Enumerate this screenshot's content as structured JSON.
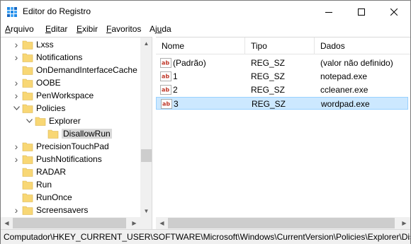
{
  "window": {
    "title": "Editor do Registro"
  },
  "menu": [
    {
      "accel": "A",
      "rest": "rquivo"
    },
    {
      "accel": "E",
      "rest": "ditar"
    },
    {
      "accel": "E",
      "rest": "xibir"
    },
    {
      "accel": "F",
      "rest": "avoritos"
    },
    {
      "pre": "Aj",
      "accel": "u",
      "rest": "da"
    }
  ],
  "tree": {
    "items": [
      {
        "label": "Lxss",
        "expander": "right"
      },
      {
        "label": "Notifications",
        "expander": "right"
      },
      {
        "label": "OnDemandInterfaceCache",
        "expander": "none"
      },
      {
        "label": "OOBE",
        "expander": "right"
      },
      {
        "label": "PenWorkspace",
        "expander": "right"
      },
      {
        "label": "Policies",
        "expander": "down"
      },
      {
        "label": "Explorer",
        "expander": "down"
      },
      {
        "label": "DisallowRun",
        "expander": "none",
        "selected": true
      },
      {
        "label": "PrecisionTouchPad",
        "expander": "right"
      },
      {
        "label": "PushNotifications",
        "expander": "right"
      },
      {
        "label": "RADAR",
        "expander": "none"
      },
      {
        "label": "Run",
        "expander": "none"
      },
      {
        "label": "RunOnce",
        "expander": "none"
      },
      {
        "label": "Screensavers",
        "expander": "right"
      }
    ]
  },
  "list": {
    "columns": {
      "name": "Nome",
      "type": "Tipo",
      "data": "Dados"
    },
    "rows": [
      {
        "name": "(Padrão)",
        "type": "REG_SZ",
        "data": "(valor não definido)"
      },
      {
        "name": "1",
        "type": "REG_SZ",
        "data": "notepad.exe"
      },
      {
        "name": "2",
        "type": "REG_SZ",
        "data": "ccleaner.exe"
      },
      {
        "name": "3",
        "type": "REG_SZ",
        "data": "wordpad.exe",
        "selected": true
      }
    ]
  },
  "status": {
    "path": "Computador\\HKEY_CURRENT_USER\\SOFTWARE\\Microsoft\\Windows\\CurrentVersion\\Policies\\Explorer\\DisallowRun"
  },
  "colors": {
    "folder": "#f8d775",
    "selection": "#cce8ff",
    "selection_border": "#99d1ff",
    "ab_icon_red": "#c0392b"
  }
}
